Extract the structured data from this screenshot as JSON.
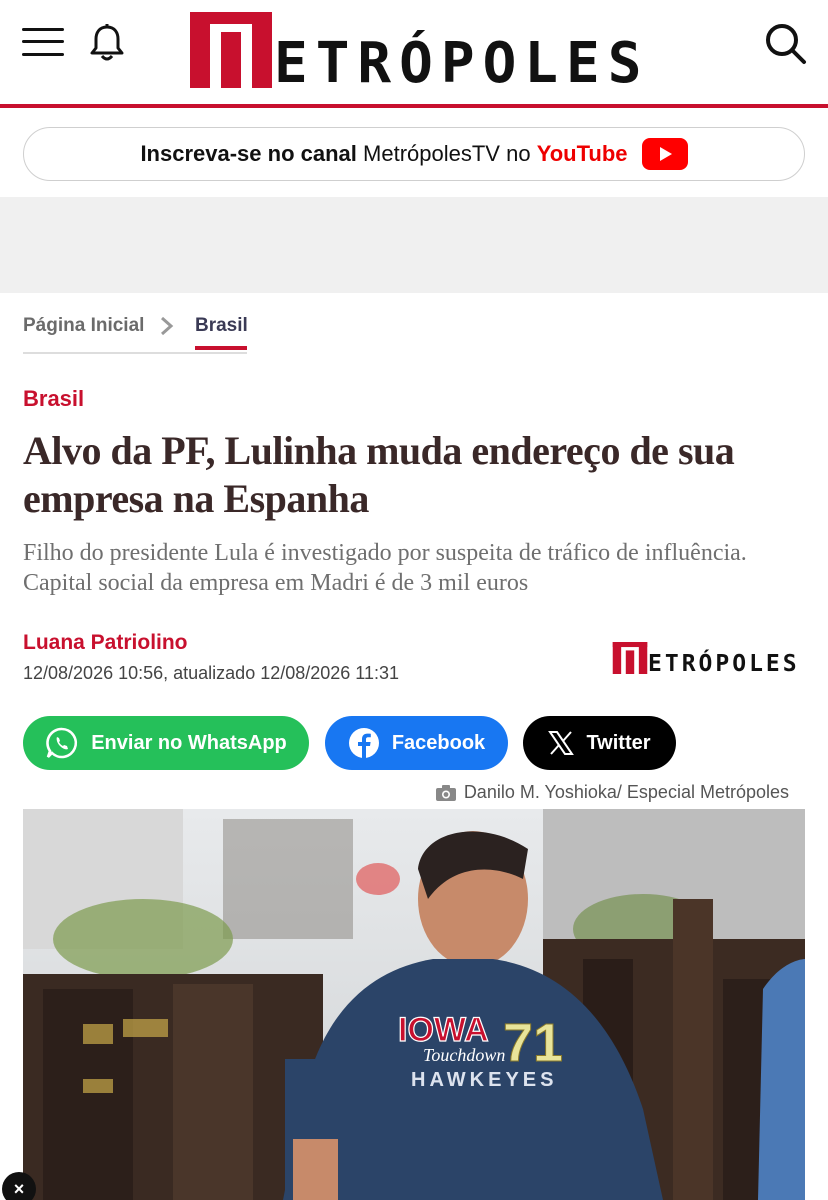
{
  "header": {
    "logo_text": "ETRÓPOLES",
    "logo_aria": "Metrópoles",
    "brand_color": "#c8102e"
  },
  "youtube_banner": {
    "prefix": "Inscreva-se no canal",
    "channel": "MetrópolesTV",
    "middle": "no",
    "platform": "YouTube",
    "icon": "youtube-icon"
  },
  "breadcrumb": {
    "home": "Página Inicial",
    "current": "Brasil"
  },
  "article": {
    "category": "Brasil",
    "headline": "Alvo da PF, Lulinha muda endereço de sua empresa na Espanha",
    "subtitle": "Filho do presidente Lula é investigado por suspeita de tráfico de influência. Capital social da empresa em Madri é de 3 mil euros",
    "author": "Luana Patriolino",
    "dates": "12/08/2026 10:56, atualizado 12/08/2026 11:31",
    "small_logo_text": "ETRÓPOLES"
  },
  "share": {
    "whatsapp": "Enviar no WhatsApp",
    "facebook": "Facebook",
    "twitter": "Twitter",
    "colors": {
      "whatsapp": "#25c05a",
      "facebook": "#1877f2",
      "twitter": "#000000"
    }
  },
  "photo": {
    "credit": "Danilo M. Yoshioka/ Especial Metrópoles",
    "shirt_line1": "IOWA",
    "shirt_number": "71",
    "shirt_line2": "Touchdown",
    "shirt_line3": "HAWKEYES"
  },
  "close_ad": "×"
}
